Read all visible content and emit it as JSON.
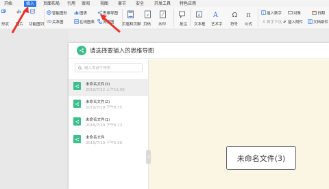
{
  "menu": {
    "tabs": [
      {
        "label": "开始"
      },
      {
        "label": "插入"
      },
      {
        "label": "页面布局"
      },
      {
        "label": "引用"
      },
      {
        "label": "审阅"
      },
      {
        "label": "视图"
      },
      {
        "label": "章节"
      },
      {
        "label": "安全"
      },
      {
        "label": "开发工具"
      },
      {
        "label": "特色应用"
      }
    ]
  },
  "ribbon": {
    "shape": "形状",
    "chart": "图表",
    "mindmap": "思维导图",
    "smartart": "智能图形",
    "relation": "关系图",
    "online_chart": "在线图表",
    "flowchart": "流程图",
    "header_footer": "页眉和页脚",
    "page_number": "页码",
    "watermark": "水印",
    "comment": "批注",
    "textbox": "文本框",
    "wordart": "艺术字",
    "symbol": "符号",
    "formula": "公式",
    "insert_number": "插入数字",
    "object": "对象",
    "date": "日期",
    "attachment": "插入附件",
    "doc_parts": "文档部件",
    "first_letter": "首字下沉",
    "function_chart": "功能图列",
    "gallery": "图片",
    "more": "截屏"
  },
  "dialog": {
    "title": "请选择要插入的思维导图",
    "search_placeholder": "输入关键字搜索",
    "files": [
      {
        "name": "未命名文件(3)",
        "date": "2019/7/22 上午11:08",
        "selected": true
      },
      {
        "name": "未命名文件(2)",
        "date": "2019/7/19 下午6:15",
        "selected": false
      },
      {
        "name": "未命名文件(1)",
        "date": "2019/7/19 下午6:12",
        "selected": false
      },
      {
        "name": "未命名文件",
        "date": "2019/7/19 下午5:56",
        "selected": false
      }
    ],
    "preview_node": "未命名文件(3)"
  },
  "colors": {
    "accent": "#2b78e4",
    "mindmap_green": "#3cbf8c",
    "preview_bg": "#fbf6e4",
    "arrow_red": "#e8312c"
  }
}
